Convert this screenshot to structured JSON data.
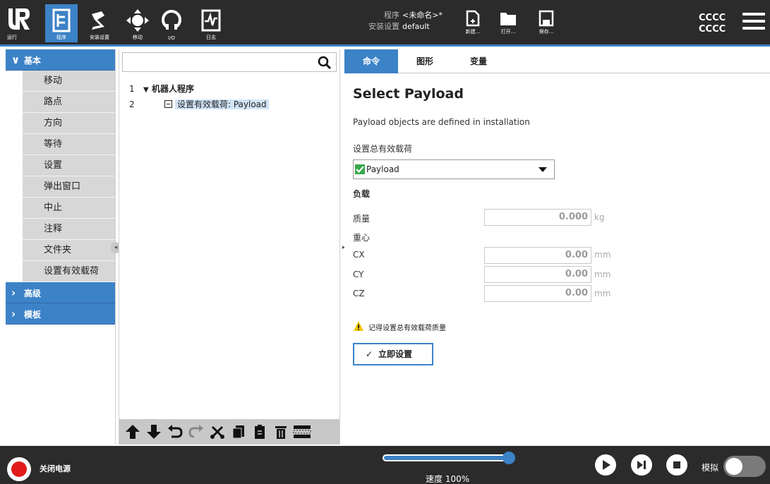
{
  "nav": {
    "logo_text": "UR",
    "tabs": [
      {
        "label": "运行",
        "icon": "run-icon"
      },
      {
        "label": "程序",
        "icon": "program-icon"
      },
      {
        "label": "安装设置",
        "icon": "installation-icon"
      },
      {
        "label": "移动",
        "icon": "move-icon"
      },
      {
        "label": "I/O",
        "icon": "io-icon"
      },
      {
        "label": "日志",
        "icon": "log-icon"
      }
    ],
    "program_key": "程序",
    "program_value": "<未命名>*",
    "installation_key": "安装设置",
    "installation_value": "default",
    "file_buttons": [
      {
        "label": "新建...",
        "icon": "new-file-icon"
      },
      {
        "label": "打开...",
        "icon": "open-folder-icon"
      },
      {
        "label": "保存...",
        "icon": "save-icon"
      }
    ],
    "user_line1": "CCCC",
    "user_line2": "CCCC"
  },
  "sidebar": {
    "categories": [
      {
        "label": "基本",
        "expanded": true
      },
      {
        "label": "高级",
        "expanded": false
      },
      {
        "label": "模板",
        "expanded": false
      }
    ],
    "basic_items": [
      "移动",
      "路点",
      "方向",
      "等待",
      "设置",
      "弹出窗口",
      "中止",
      "注释",
      "文件夹",
      "设置有效载荷"
    ]
  },
  "tree": {
    "search_placeholder": "",
    "rows": [
      {
        "num": "1",
        "label": "机器人程序"
      },
      {
        "num": "2",
        "label": "设置有效载荷: Payload"
      }
    ],
    "toolbar_icons": [
      "move-up-icon",
      "move-down-icon",
      "undo-icon",
      "redo-icon",
      "cut-icon",
      "copy-icon",
      "paste-icon",
      "delete-icon",
      "suppress-icon"
    ]
  },
  "panel": {
    "tabs": [
      "命令",
      "图形",
      "变量"
    ],
    "title": "Select Payload",
    "description": "Payload objects are defined in installation",
    "set_total_label": "设置总有效载荷",
    "payload_selected": "Payload",
    "load_section": "负载",
    "mass_label": "质量",
    "mass_value": "0.000",
    "mass_unit": "kg",
    "cog_label": "重心",
    "cx_label": "CX",
    "cx_value": "0.00",
    "cy_label": "CY",
    "cy_value": "0.00",
    "cz_label": "CZ",
    "cz_value": "0.00",
    "length_unit": "mm",
    "warning": "记得设置总有效载荷质量",
    "set_now_label": "立即设置"
  },
  "bottom": {
    "power_label": "关闭电源",
    "speed_label": "速度 100%",
    "speed_fraction": 1.0,
    "sim_label": "模拟"
  },
  "colors": {
    "accent": "#3c82c7",
    "topbar": "#2b2b2b",
    "power": "#e11b1b",
    "ok_green": "#36a84a"
  }
}
